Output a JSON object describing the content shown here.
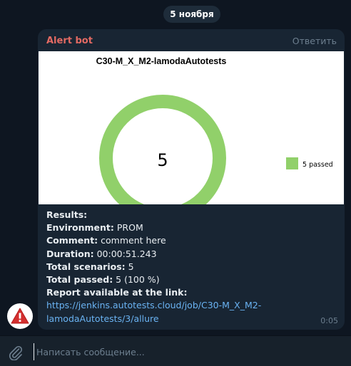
{
  "date_pill": "5 ноября",
  "message": {
    "sender": "Alert bot",
    "reply_label": "Ответить",
    "time": "0:05",
    "chart": {
      "title": "C30-M_X_M2-lamodaAutotests",
      "center_value": "5",
      "legend_label": "5 passed",
      "color": "#91d06a"
    },
    "lines": [
      {
        "label": "Results:",
        "value": ""
      },
      {
        "label": "Environment:",
        "value": " PROM"
      },
      {
        "label": "Comment:",
        "value": " comment here"
      },
      {
        "label": "Duration:",
        "value": " 00:00:51.243"
      },
      {
        "label": "Total scenarios:",
        "value": " 5"
      },
      {
        "label": "Total passed:",
        "value": " 5 (100 %)"
      },
      {
        "label": "Report available at the link:",
        "value": ""
      }
    ],
    "link_line1": "https://jenkins.autotests.cloud/job/C30-M_X_M2-",
    "link_line2": "lamodaAutotests/3/allure"
  },
  "composer": {
    "placeholder": "Написать сообщение..."
  },
  "chart_data": {
    "type": "pie",
    "title": "C30-M_X_M2-lamodaAutotests",
    "categories": [
      "5 passed"
    ],
    "values": [
      5
    ],
    "colors": [
      "#91d06a"
    ],
    "donut": true,
    "center_label": "5",
    "legend_position": "right"
  },
  "colors": {
    "background": "#0e1621",
    "bubble": "#182533",
    "sender": "#e36a63",
    "link": "#6ab3f3",
    "passed": "#91d06a"
  }
}
